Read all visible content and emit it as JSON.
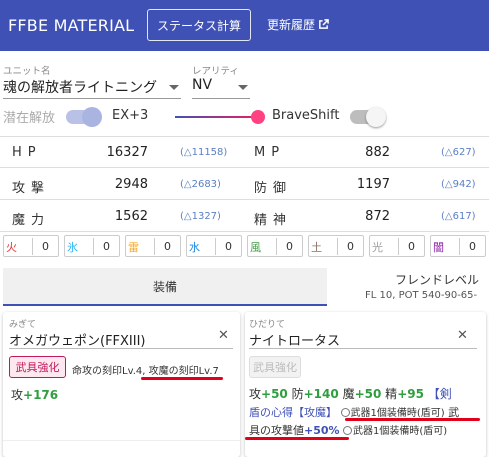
{
  "header": {
    "title": "FFBE MATERIAL",
    "status_button": "ステータス計算",
    "changelog_link": "更新履歴",
    "bg_color": "#3f51b5"
  },
  "unit": {
    "label": "ユニット名",
    "value": "魂の解放者ライトニング",
    "rarity_label": "レアリティ",
    "rarity_value": "NV"
  },
  "toggles": {
    "latent_label": "潜在解放",
    "ex_label": "EX+3",
    "braveshift_label": "BraveShift",
    "latent_on": false,
    "braveshift_on": false
  },
  "stats": [
    {
      "name": "HP",
      "value": "16327",
      "diff": "(△11158)",
      "name2": "MP",
      "value2": "882",
      "diff2": "(△627)"
    },
    {
      "name": "攻撃",
      "value": "2948",
      "diff": "(△2683)",
      "name2": "防御",
      "value2": "1197",
      "diff2": "(△942)"
    },
    {
      "name": "魔力",
      "value": "1562",
      "diff": "(△1327)",
      "name2": "精神",
      "value2": "872",
      "diff2": "(△617)"
    }
  ],
  "elements": [
    {
      "name": "火",
      "value": "0",
      "color": "#e53935"
    },
    {
      "name": "氷",
      "value": "0",
      "color": "#29b6f6"
    },
    {
      "name": "雷",
      "value": "0",
      "color": "#f9a825"
    },
    {
      "name": "水",
      "value": "0",
      "color": "#1e88e5"
    },
    {
      "name": "風",
      "value": "0",
      "color": "#43a047"
    },
    {
      "name": "土",
      "value": "0",
      "color": "#8d6e63"
    },
    {
      "name": "光",
      "value": "0",
      "color": "#9e9e9e"
    },
    {
      "name": "闇",
      "value": "0",
      "color": "#8e24aa"
    }
  ],
  "tabs": {
    "equipment": "装備",
    "friend_level": "フレンドレベル",
    "friend_sub": "FL 10, POT 540-90-65-"
  },
  "right_hand": {
    "slot_label": "みぎて",
    "item": "オメガウェポン(FFXIII)",
    "enhance_button": "武具強化",
    "engravings": "命攻の刻印Lv.4, 攻魔の刻印Lv.7",
    "stat_label": "攻",
    "stat_value": "+176"
  },
  "left_hand": {
    "slot_label": "ひだりて",
    "item": "ナイトロータス",
    "enhance_button": "武具強化",
    "stats": [
      {
        "label": "攻",
        "value": "+50"
      },
      {
        "label": "防",
        "value": "+140"
      },
      {
        "label": "魔",
        "value": "+50"
      },
      {
        "label": "精",
        "value": "+95"
      }
    ],
    "ability_a": "【剣",
    "ability_b": "盾の心得【攻魔】",
    "cond1": "武器1個装備時(盾可)",
    "cond1_tail": "武",
    "effect": "具の攻撃値",
    "effect_value": "+50%",
    "cond2": "武器1個装備時(盾可)"
  }
}
